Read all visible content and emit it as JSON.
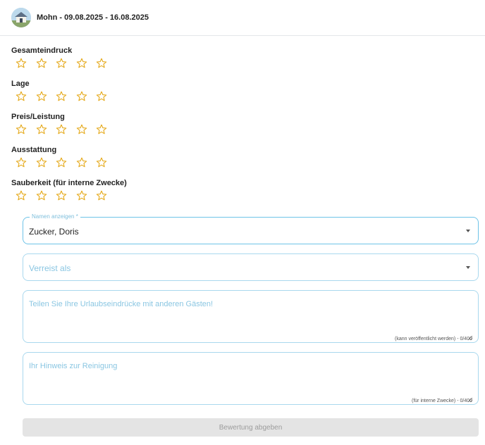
{
  "header": {
    "title": "Mohn - 09.08.2025 - 16.08.2025",
    "avatar_icon": "house-photo-icon"
  },
  "ratings": [
    {
      "label": "Gesamteindruck",
      "value": 0,
      "max": 5
    },
    {
      "label": "Lage",
      "value": 0,
      "max": 5
    },
    {
      "label": "Preis/Leistung",
      "value": 0,
      "max": 5
    },
    {
      "label": "Ausstattung",
      "value": 0,
      "max": 5
    },
    {
      "label": "Sauberkeit (für interne Zwecke)",
      "value": 0,
      "max": 5
    }
  ],
  "form": {
    "name_select": {
      "label": "Namen anzeigen *",
      "value": "Zucker, Doris"
    },
    "travel_select": {
      "placeholder": "Verreist als",
      "value": ""
    },
    "experience": {
      "placeholder": "Teilen Sie Ihre Urlaubseindrücke mit anderen Gästen!",
      "value": "",
      "counter": "(kann veröffentlicht werden) - 0/400"
    },
    "cleaning": {
      "placeholder": "Ihr Hinweis zur Reinigung",
      "value": "",
      "counter": "(für interne Zwecke) - 0/400"
    },
    "submit_label": "Bewertung abgeben"
  },
  "colors": {
    "star_outline": "#e5a91a",
    "field_border": "#a9d8ee",
    "placeholder": "#8ac6e2",
    "submit_bg": "#e4e4e4",
    "submit_text": "#9c9c9c"
  }
}
